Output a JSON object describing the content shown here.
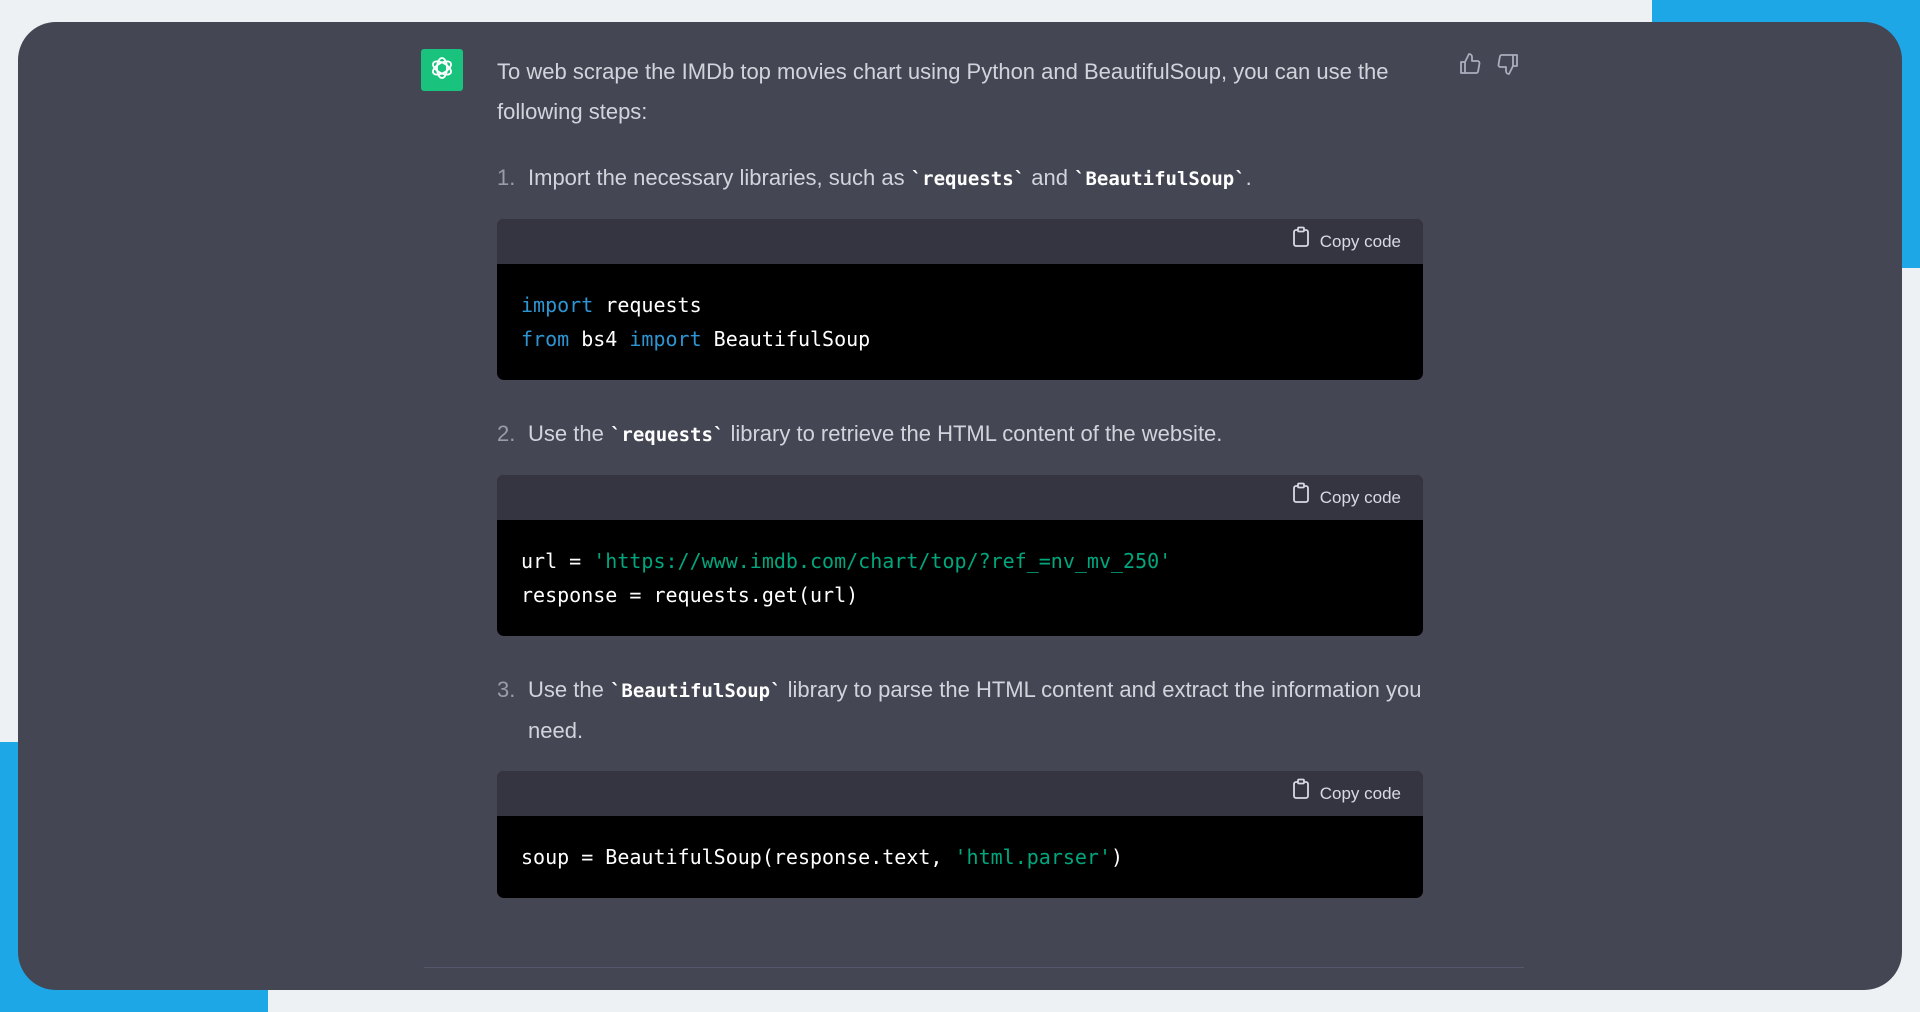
{
  "message": {
    "intro": "To web scrape the IMDb top movies chart using Python and BeautifulSoup, you can use the following steps:",
    "copy_label": "Copy code",
    "steps": [
      {
        "number": "1.",
        "parts": [
          "Import the necessary libraries, such as ",
          "`requests`",
          " and ",
          "`BeautifulSoup`",
          "."
        ],
        "code": {
          "line1": {
            "kw1": "import",
            "t1": " requests"
          },
          "line2": {
            "kw1": "from",
            "t1": " bs4 ",
            "kw2": "import",
            "t2": " BeautifulSoup"
          }
        }
      },
      {
        "number": "2.",
        "parts": [
          "Use the ",
          "`requests`",
          " library to retrieve the HTML content of the website."
        ],
        "code": {
          "line1": {
            "t1": "url = ",
            "s1": "'https://www.imdb.com/chart/top/?ref_=nv_mv_250'"
          },
          "line2": {
            "t1": "response = requests.get(url)"
          }
        }
      },
      {
        "number": "3.",
        "parts": [
          "Use the ",
          "`BeautifulSoup`",
          " library to parse the HTML content and extract the information you need."
        ],
        "code": {
          "line1": {
            "t1": "soup = BeautifulSoup(response.text, ",
            "s1": "'html.parser'",
            "t2": ")"
          }
        }
      }
    ]
  },
  "icons": {
    "avatar": "openai-logo-icon",
    "thumbs_up": "thumbs-up-icon",
    "thumbs_down": "thumbs-down-icon",
    "copy": "clipboard-icon"
  },
  "colors": {
    "panel": "#444654",
    "avatar": "#19c37d",
    "code_bg": "#000000",
    "code_header": "#343541",
    "keyword": "#2e95d3",
    "string": "#00a67d",
    "accent_blue": "#1ea7e6"
  }
}
